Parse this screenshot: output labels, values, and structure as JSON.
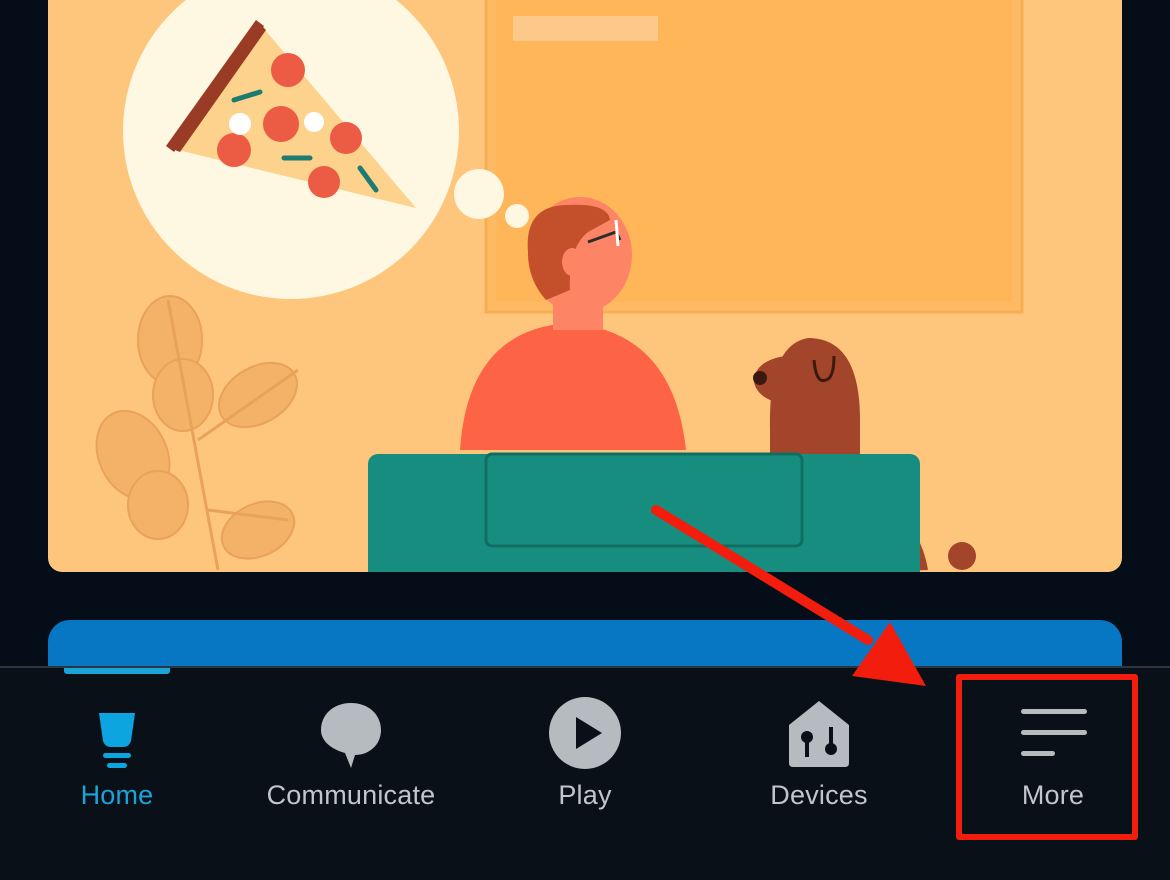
{
  "tabs": [
    {
      "label": "Home",
      "icon": "home-icon",
      "active": true
    },
    {
      "label": "Communicate",
      "icon": "speech-bubble-icon",
      "active": false
    },
    {
      "label": "Play",
      "icon": "play-icon",
      "active": false
    },
    {
      "label": "Devices",
      "icon": "devices-house-icon",
      "active": false
    },
    {
      "label": "More",
      "icon": "menu-lines-icon",
      "active": false
    }
  ],
  "colors": {
    "accent": "#1aa3d9",
    "annotation": "#f21d0c",
    "banner": "#0877c3",
    "background": "#050d18"
  }
}
